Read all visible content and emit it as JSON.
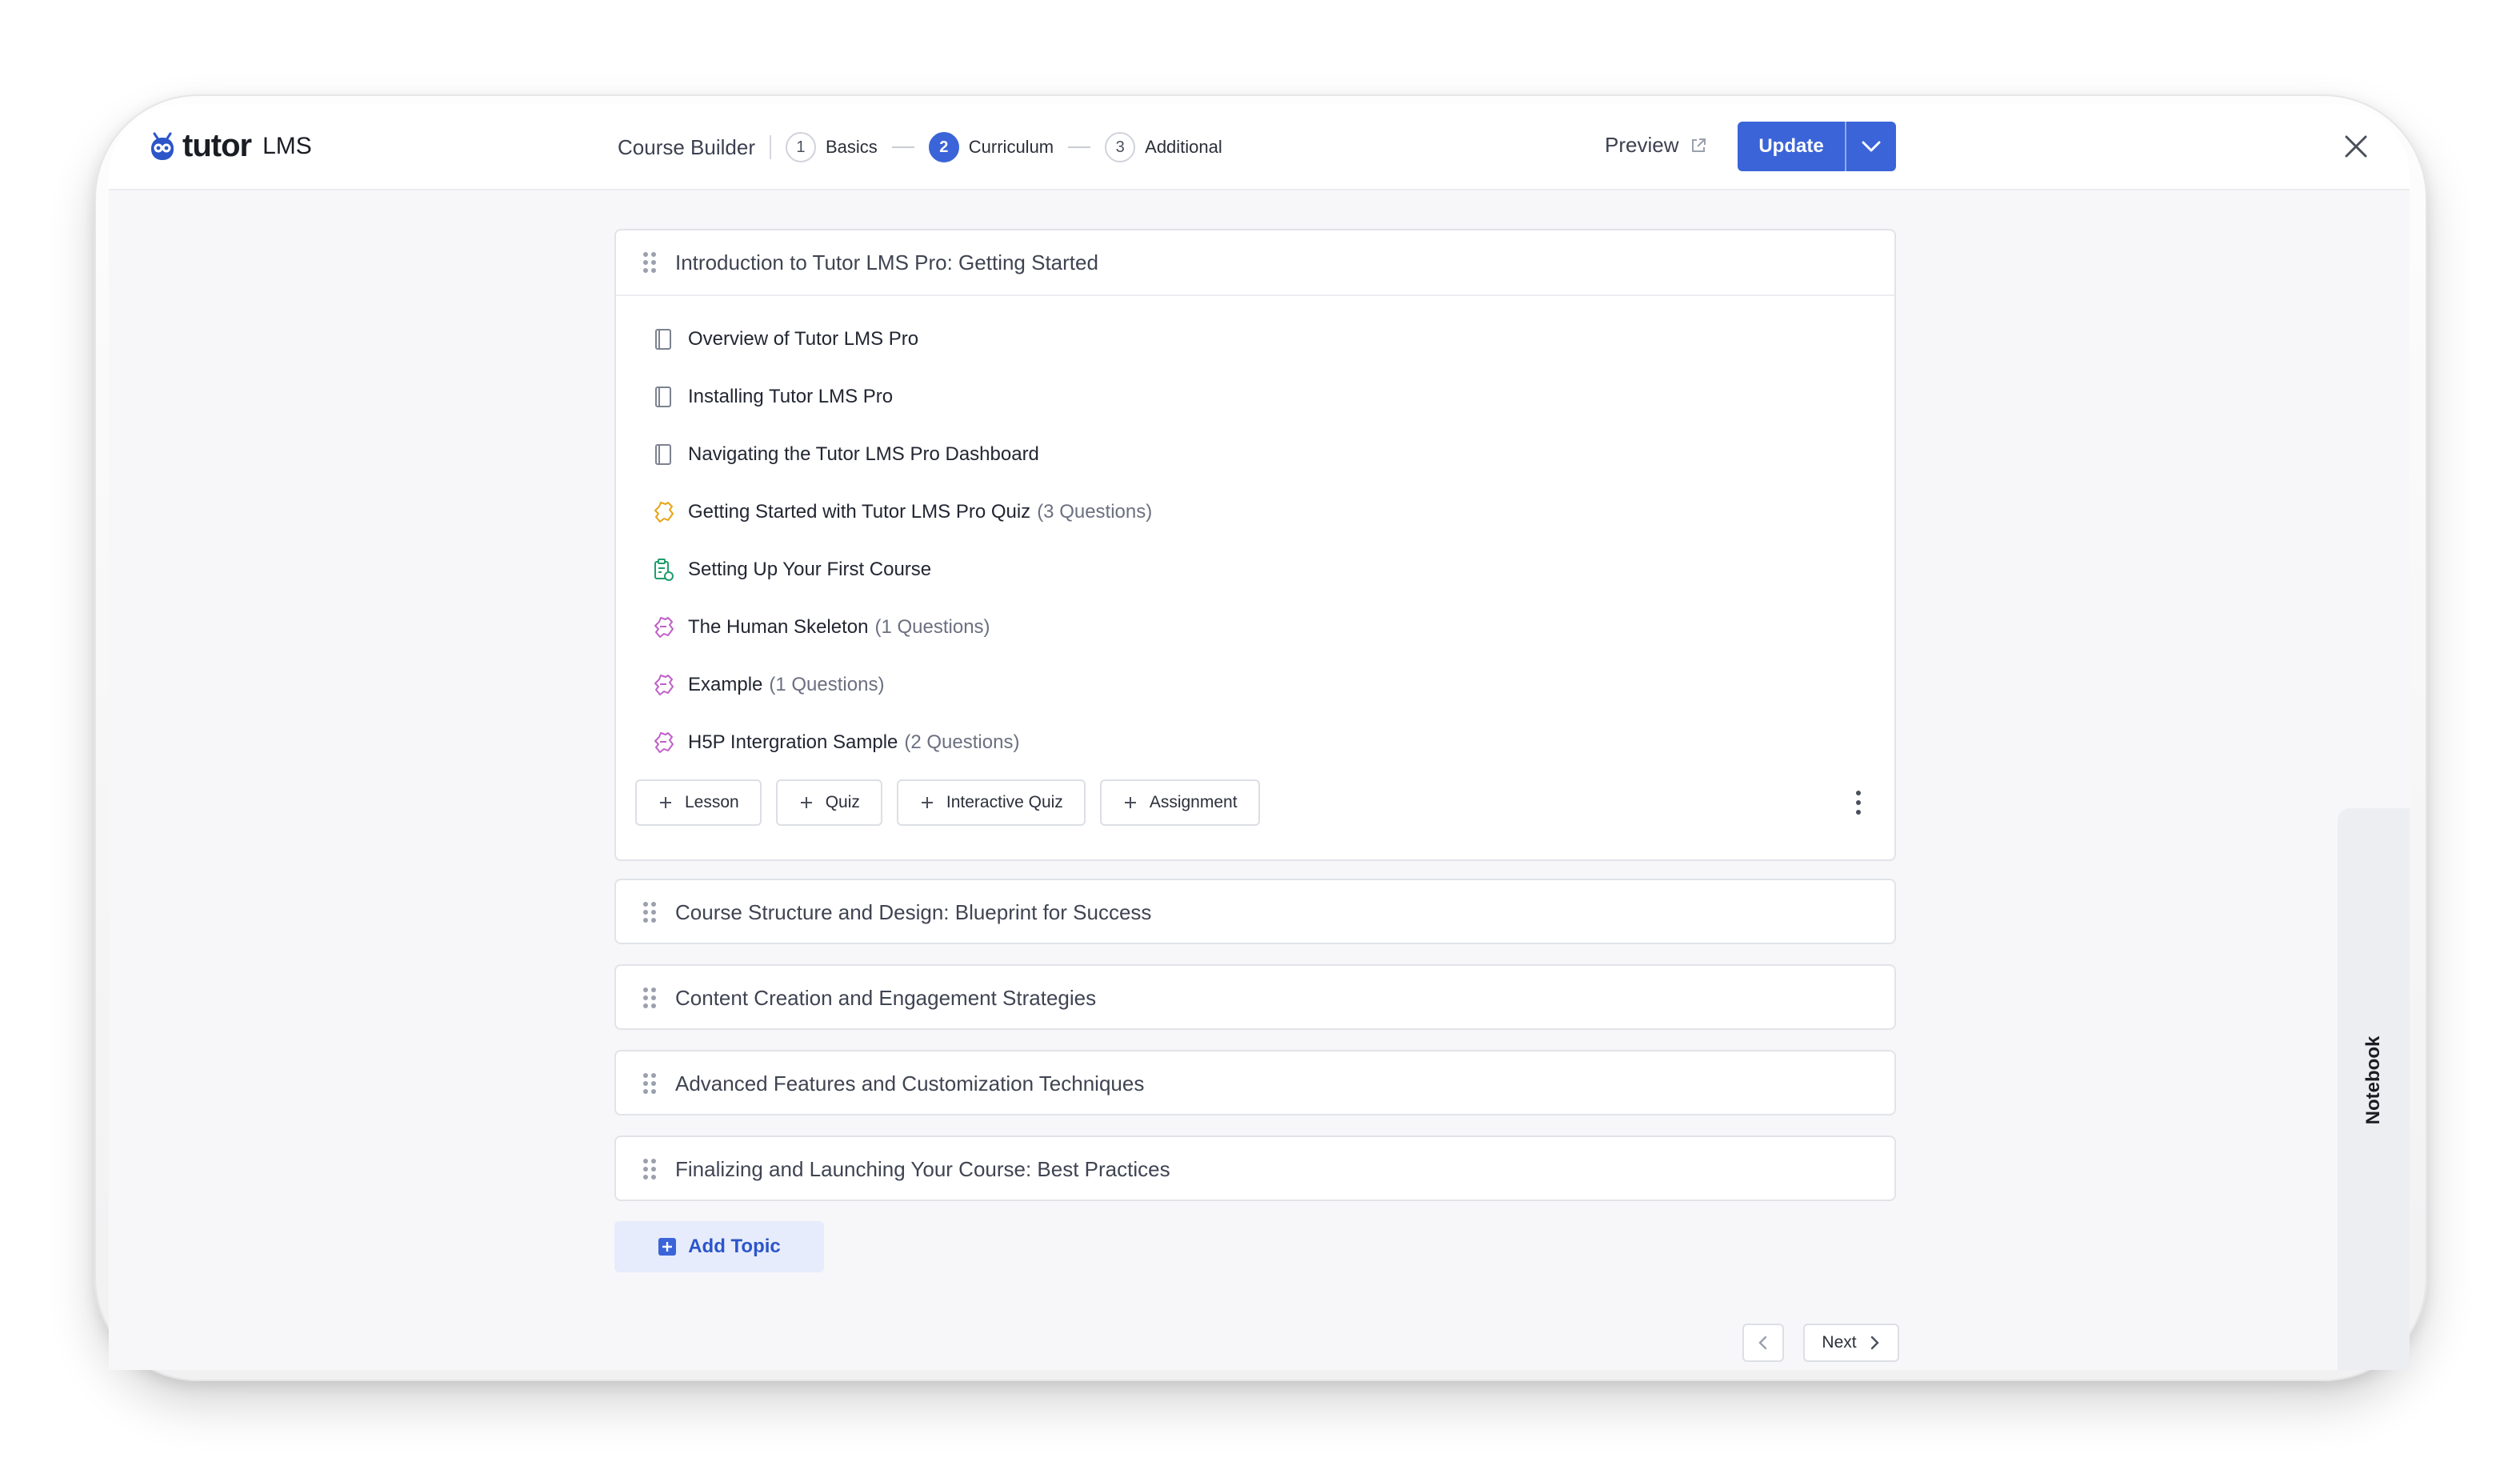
{
  "header": {
    "logo_word": "tutor",
    "logo_suffix": "LMS",
    "course_builder": "Course Builder",
    "steps": [
      {
        "num": "1",
        "label": "Basics",
        "active": false
      },
      {
        "num": "2",
        "label": "Curriculum",
        "active": true
      },
      {
        "num": "3",
        "label": "Additional",
        "active": false
      }
    ],
    "preview": "Preview",
    "update": "Update"
  },
  "topics": [
    {
      "title": "Introduction to Tutor LMS Pro: Getting Started",
      "expanded": true,
      "items": [
        {
          "icon": "lesson-icon",
          "title": "Overview of Tutor LMS Pro",
          "meta": ""
        },
        {
          "icon": "lesson-icon",
          "title": "Installing Tutor LMS Pro",
          "meta": ""
        },
        {
          "icon": "lesson-icon",
          "title": "Navigating the Tutor LMS Pro Dashboard",
          "meta": ""
        },
        {
          "icon": "quiz-icon",
          "title": "Getting Started with Tutor LMS Pro Quiz",
          "meta": "(3 Questions)"
        },
        {
          "icon": "assignment-icon",
          "title": "Setting Up Your First Course",
          "meta": ""
        },
        {
          "icon": "interactive-quiz-icon",
          "title": "The Human Skeleton",
          "meta": "(1 Questions)"
        },
        {
          "icon": "interactive-quiz-icon",
          "title": "Example",
          "meta": "(1 Questions)"
        },
        {
          "icon": "interactive-quiz-icon",
          "title": "H5P Intergration Sample",
          "meta": "(2 Questions)"
        }
      ],
      "add_buttons": [
        "Lesson",
        "Quiz",
        "Interactive Quiz",
        "Assignment"
      ]
    },
    {
      "title": "Course Structure and Design: Blueprint for Success"
    },
    {
      "title": "Content Creation and Engagement Strategies"
    },
    {
      "title": "Advanced Features and Customization Techniques"
    },
    {
      "title": "Finalizing and Launching Your Course: Best Practices"
    }
  ],
  "add_topic": "Add Topic",
  "pager": {
    "next": "Next"
  },
  "notebook": "Notebook",
  "colors": {
    "accent": "#3a64d8",
    "quiz": "#e8a316",
    "assignment": "#1f9d6b",
    "interactive": "#c060c8"
  }
}
